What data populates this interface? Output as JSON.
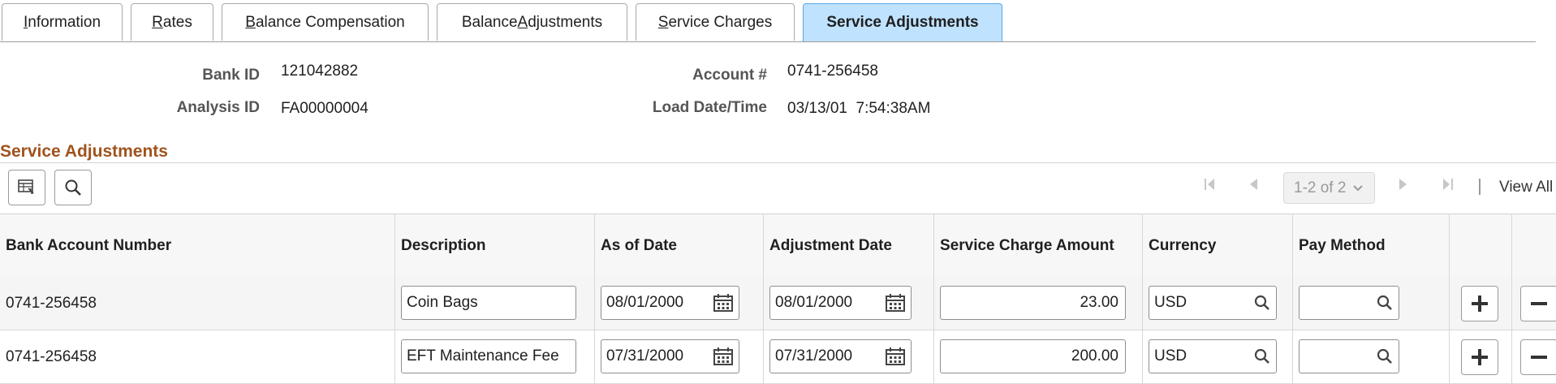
{
  "tabs": [
    {
      "pre": "",
      "ul": "I",
      "post": "nformation"
    },
    {
      "pre": "",
      "ul": "R",
      "post": "ates"
    },
    {
      "pre": "",
      "ul": "B",
      "post": "alance Compensation"
    },
    {
      "pre": "Balance ",
      "ul": "A",
      "post": "djustments"
    },
    {
      "pre": "",
      "ul": "S",
      "post": "ervice Charges"
    },
    {
      "pre": "Service Adjustments",
      "ul": "",
      "post": ""
    }
  ],
  "header": {
    "bank_id_label": "Bank ID",
    "bank_id": "121042882",
    "analysis_id_label": "Analysis ID",
    "analysis_id": "FA00000004",
    "account_label": "Account #",
    "account": "0741-256458",
    "load_label": "Load Date/Time",
    "load_value": "03/13/01  7:54:38AM"
  },
  "section": {
    "title": "Service Adjustments"
  },
  "pager": {
    "range": "1-2 of 2",
    "view_all": "View All"
  },
  "columns": [
    "Bank Account Number",
    "Description",
    "As of Date",
    "Adjustment Date",
    "Service Charge Amount",
    "Currency",
    "Pay Method"
  ],
  "rows": [
    {
      "account": "0741-256458",
      "description": "Coin Bags",
      "as_of": "08/01/2000",
      "adj_date": "08/01/2000",
      "amount": "23.00",
      "currency": "USD",
      "pay_method": ""
    },
    {
      "account": "0741-256458",
      "description": "EFT Maintenance Fee",
      "as_of": "07/31/2000",
      "adj_date": "07/31/2000",
      "amount": "200.00",
      "currency": "USD",
      "pay_method": ""
    }
  ],
  "colors": {
    "active_tab": "#bfe2ff",
    "section_title": "#a0531e"
  }
}
